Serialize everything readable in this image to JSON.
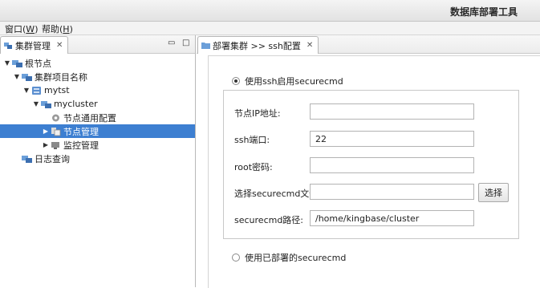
{
  "app": {
    "title": "数据库部署工具"
  },
  "menu": [
    {
      "label": "窗口(",
      "key": "W",
      "tail": ")"
    },
    {
      "label": "帮助(",
      "key": "H",
      "tail": ")"
    }
  ],
  "left_panel": {
    "tab_label": "集群管理",
    "close_glyph": "✕",
    "minimize_glyph": "▭",
    "maximize_glyph": "□",
    "tree": [
      {
        "label": "根节点",
        "expanded": true
      },
      {
        "label": "集群项目名称",
        "expanded": true
      },
      {
        "label": "mytst",
        "expanded": true
      },
      {
        "label": "mycluster",
        "expanded": true
      },
      {
        "label": "节点通用配置"
      },
      {
        "label": "节点管理",
        "selected": true,
        "expandable": true
      },
      {
        "label": "监控管理",
        "expandable": true
      },
      {
        "label": "日志查询"
      }
    ]
  },
  "right_panel": {
    "tab_label": "部署集群 >> ssh配置",
    "close_glyph": "✕",
    "option_ssh": {
      "label": "使用ssh启用securecmd",
      "checked": true
    },
    "fields": {
      "node_ip": {
        "label": "节点IP地址:",
        "value": ""
      },
      "ssh_port": {
        "label": "ssh端口:",
        "value": "22"
      },
      "root_password": {
        "label": "root密码:",
        "value": ""
      },
      "securecmd_file": {
        "label": "选择securecmd文件:",
        "value": ""
      },
      "securecmd_path": {
        "label": "securecmd路径:",
        "value": "/home/kingbase/cluster"
      }
    },
    "choose_button": "选择",
    "option_deployed": {
      "label": "使用已部署的securecmd",
      "checked": false
    }
  },
  "colors": {
    "selection": "#3d7fd1",
    "folder_blue": "#6b9fd9"
  }
}
